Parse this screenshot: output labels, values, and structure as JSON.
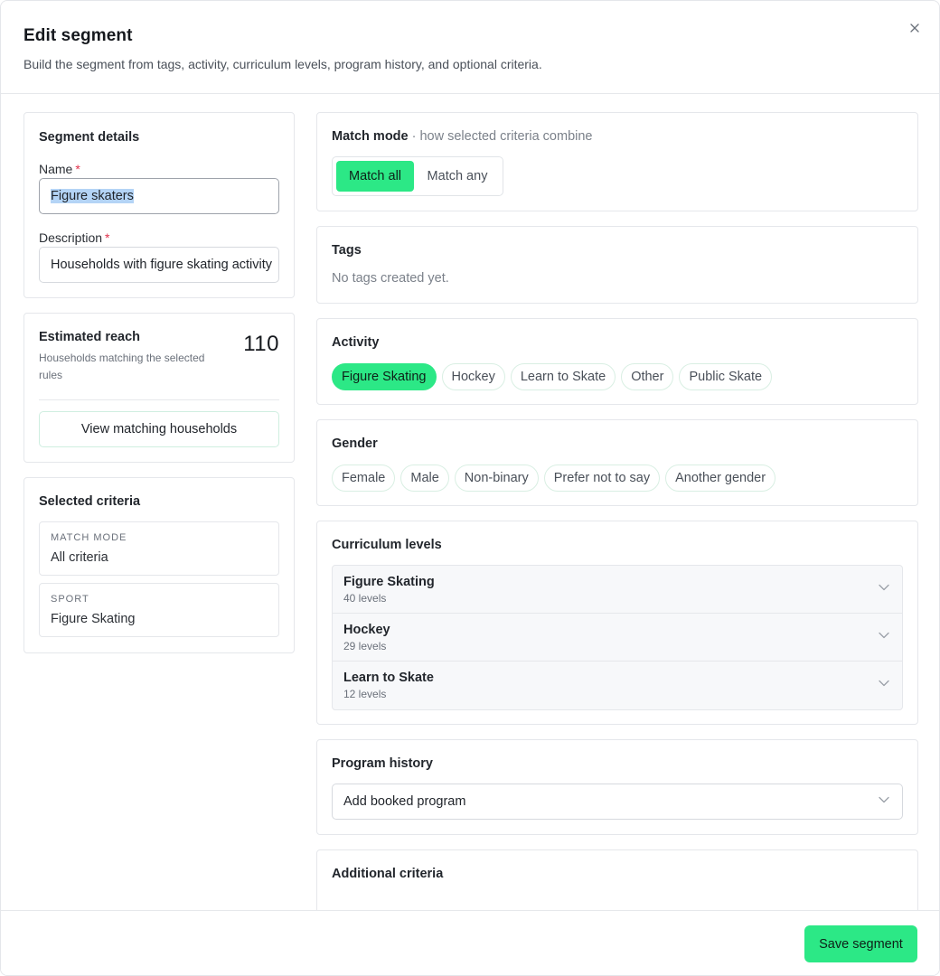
{
  "header": {
    "title": "Edit segment",
    "subtitle": "Build the segment from tags, activity, curriculum levels, program history, and optional criteria."
  },
  "details": {
    "title": "Segment details",
    "name_label": "Name",
    "name_value": "Figure skaters",
    "description_label": "Description",
    "description_value": "Households with figure skating activity",
    "required_mark": "*"
  },
  "reach": {
    "title": "Estimated reach",
    "value": "110",
    "description": "Households matching the selected rules",
    "view_button": "View matching households"
  },
  "selected": {
    "title": "Selected criteria",
    "items": [
      {
        "key": "MATCH MODE",
        "value": "All criteria"
      },
      {
        "key": "SPORT",
        "value": "Figure Skating"
      }
    ]
  },
  "match_mode": {
    "title": "Match mode",
    "hint": "· how selected criteria combine",
    "options": [
      "Match all",
      "Match any"
    ],
    "selected": "Match all"
  },
  "tags": {
    "title": "Tags",
    "empty": "No tags created yet."
  },
  "activity": {
    "title": "Activity",
    "options": [
      "Figure Skating",
      "Hockey",
      "Learn to Skate",
      "Other",
      "Public Skate"
    ],
    "selected": "Figure Skating"
  },
  "gender": {
    "title": "Gender",
    "options": [
      "Female",
      "Male",
      "Non-binary",
      "Prefer not to say",
      "Another gender"
    ]
  },
  "curriculum": {
    "title": "Curriculum levels",
    "items": [
      {
        "name": "Figure Skating",
        "count": "40 levels"
      },
      {
        "name": "Hockey",
        "count": "29 levels"
      },
      {
        "name": "Learn to Skate",
        "count": "12 levels"
      }
    ]
  },
  "program_history": {
    "title": "Program history",
    "select_value": "Add booked program"
  },
  "additional": {
    "title": "Additional criteria"
  },
  "footer": {
    "save_label": "Save segment"
  },
  "colors": {
    "accent": "#2ce886",
    "required": "#e0314b",
    "selection_highlight": "#b4d4f6"
  },
  "icons": {
    "close": "close-icon",
    "chevron": "chevron-down-icon"
  }
}
